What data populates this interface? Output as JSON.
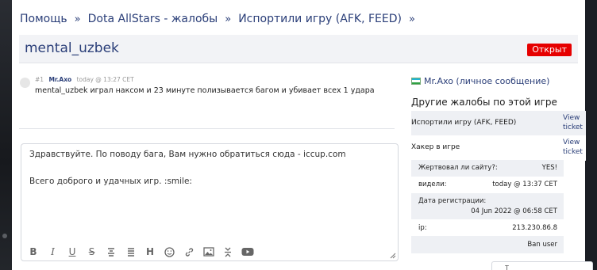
{
  "breadcrumb": {
    "items": [
      "Помощь",
      "Dota AllStars - жалобы",
      "Испортили игру (AFK, FEED)"
    ],
    "separator": "»"
  },
  "ticket": {
    "title": "mental_uzbek",
    "status": "Открыт",
    "status_color": "#e60000"
  },
  "post": {
    "number": "#1",
    "author": "Mr.Axo",
    "time": "today @ 13:27 CET",
    "text": "mental_uzbek играл наксом и 23 минуте полизывается багом и убивает всех 1 удара"
  },
  "editor": {
    "line1": "Здравствуйте. По поводу бага, Вам нужно обратиться сюда - iccup.com",
    "line2": "Всего доброго и удачных игр.  :smile:",
    "toolbar_icons": [
      "bold-icon",
      "italic-icon",
      "underline-icon",
      "strikethrough-icon",
      "align-center-icon",
      "align-left-icon",
      "heading-icon",
      "emoji-icon",
      "link-icon",
      "image-icon",
      "collapse-icon",
      "youtube-icon"
    ],
    "toolbar_labels": {
      "bold": "B",
      "italic": "I",
      "underline": "U",
      "strike": "S",
      "heading": "H"
    }
  },
  "sidebar": {
    "pm_link": "Mr.Axo (личное сообщение)",
    "other_heading": "Другие жалобы по этой игре",
    "tickets": [
      {
        "name": "Испортили игру (AFK, FEED)",
        "view": "View ticket"
      },
      {
        "name": "Хакер в игре",
        "view": "View ticket"
      }
    ],
    "info": {
      "victim_label": "Жертвовал ли сайту?:",
      "victim_value": "YES!",
      "seen_label": "видели:",
      "seen_value": "today @ 13:37 CET",
      "reg_label": "Дата регистрации:",
      "reg_value": "04 Jun 2022 @ 06:58 CET",
      "ip_label": "ip:",
      "ip_value": "213.230.86.8"
    },
    "ban_link": "Ban user"
  },
  "bottom_widget": {
    "text": "T"
  },
  "colors": {
    "link": "#2a3e78",
    "accent_red": "#e60000",
    "panel_bg": "#eef0f4"
  }
}
